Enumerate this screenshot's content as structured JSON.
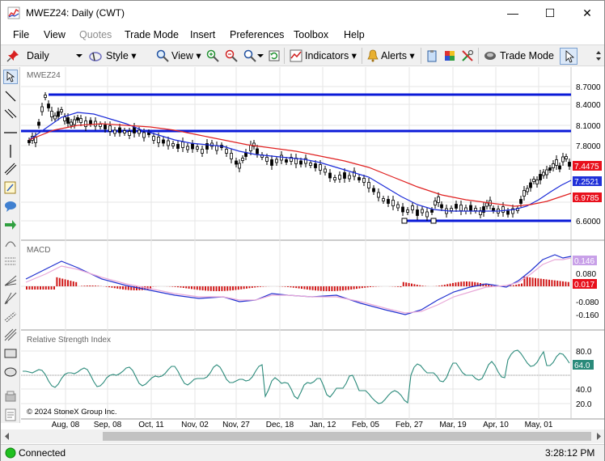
{
  "window": {
    "title": "MWEZ24: Daily (CWT)",
    "minimize_glyph": "—",
    "maximize_glyph": "☐",
    "close_glyph": "✕"
  },
  "menu": [
    {
      "label": "File",
      "enabled": true
    },
    {
      "label": "View",
      "enabled": true
    },
    {
      "label": "Quotes",
      "enabled": false
    },
    {
      "label": "Trade Mode",
      "enabled": true
    },
    {
      "label": "Insert",
      "enabled": true
    },
    {
      "label": "Preferences",
      "enabled": true
    },
    {
      "label": "Toolbox",
      "enabled": true
    },
    {
      "label": "Help",
      "enabled": true
    }
  ],
  "toolbar": {
    "interval": "Daily",
    "style_label": "Style",
    "view_label": "View",
    "indicators_label": "Indicators",
    "alerts_label": "Alerts",
    "trade_mode_label": "Trade Mode"
  },
  "chart": {
    "symbol": "MWEZ24",
    "copyright": "© 2024 StoneX Group Inc.",
    "x_labels": [
      "Aug, 08",
      "Sep, 08",
      "Oct, 11",
      "Nov, 02",
      "Nov, 27",
      "Dec, 18",
      "Jan, 12",
      "Feb, 05",
      "Feb, 27",
      "Mar, 19",
      "Apr, 10",
      "May, 01"
    ],
    "price_axis": [
      "8.7000",
      "8.4000",
      "8.1000",
      "7.8000",
      "6.6000"
    ],
    "price_tags": [
      {
        "label": "7.4475",
        "color": "#e8101c"
      },
      {
        "label": "7.2521",
        "color": "#2030d8"
      },
      {
        "label": "6.9785",
        "color": "#e8101c"
      }
    ],
    "macd": {
      "title": "MACD",
      "axis": [
        "0.080",
        "-0.080",
        "-0.160"
      ],
      "tags": [
        {
          "label": "0.146",
          "color": "#c8a0e8"
        },
        {
          "label": "0.017",
          "color": "#e8101c"
        }
      ]
    },
    "rsi": {
      "title": "Relative Strength Index",
      "axis": [
        "80.0",
        "40.0",
        "20.0"
      ],
      "tag": {
        "label": "64.0",
        "color": "#2a8a7a"
      }
    }
  },
  "status": {
    "connection": "Connected",
    "time": "3:28:12 PM"
  },
  "colors": {
    "hline": "#0a1ad8",
    "ma_fast": "#1a2ad8",
    "ma_slow": "#e02020",
    "macd_hist": "#d01818",
    "macd_line": "#2030d0",
    "macd_signal": "#e8a8d8",
    "rsi": "#2a8a7a",
    "candle": "#000000",
    "grid": "#e6e6e6"
  }
}
